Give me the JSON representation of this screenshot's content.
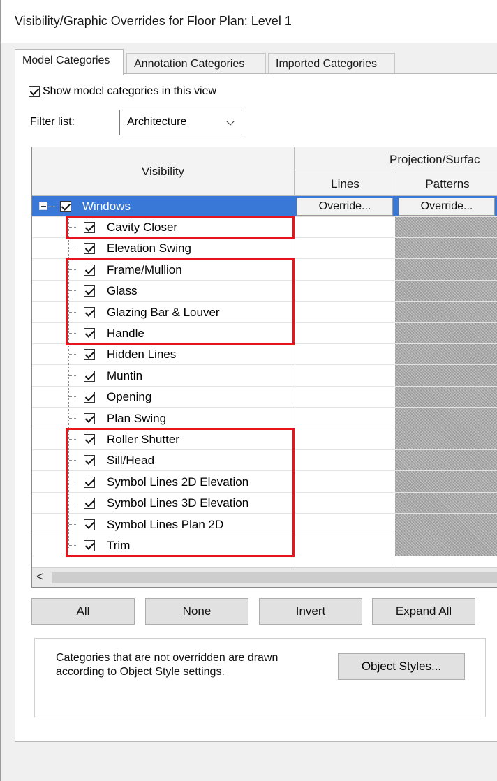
{
  "window": {
    "title": "Visibility/Graphic Overrides for Floor Plan: Level 1"
  },
  "tabs": [
    {
      "label": "Model Categories",
      "active": true
    },
    {
      "label": "Annotation Categories",
      "active": false
    },
    {
      "label": "Imported Categories",
      "active": false
    }
  ],
  "show_model_categories": {
    "label": "Show model categories in this view",
    "checked": true
  },
  "filter": {
    "label": "Filter list:",
    "value": "Architecture"
  },
  "table": {
    "header": {
      "visibility": "Visibility",
      "projection_surface": "Projection/Surfac",
      "lines": "Lines",
      "patterns": "Patterns"
    },
    "parent": {
      "name": "Windows",
      "checked": true,
      "selected": true,
      "lines_button": "Override...",
      "patterns_button": "Override..."
    },
    "children": [
      {
        "name": "Cavity Closer",
        "checked": true
      },
      {
        "name": "Elevation Swing",
        "checked": true
      },
      {
        "name": "Frame/Mullion",
        "checked": true
      },
      {
        "name": "Glass",
        "checked": true
      },
      {
        "name": "Glazing Bar & Louver",
        "checked": true
      },
      {
        "name": "Handle",
        "checked": true
      },
      {
        "name": "Hidden Lines",
        "checked": true
      },
      {
        "name": "Muntin",
        "checked": true
      },
      {
        "name": "Opening",
        "checked": true
      },
      {
        "name": "Plan Swing",
        "checked": true
      },
      {
        "name": "Roller Shutter",
        "checked": true
      },
      {
        "name": "Sill/Head",
        "checked": true
      },
      {
        "name": "Symbol Lines 2D Elevation",
        "checked": true
      },
      {
        "name": "Symbol Lines 3D Elevation",
        "checked": true
      },
      {
        "name": "Symbol Lines Plan 2D",
        "checked": true
      },
      {
        "name": "Trim",
        "checked": true
      }
    ]
  },
  "scrollbar": {
    "left_arrow": "<"
  },
  "buttons": {
    "all": "All",
    "none": "None",
    "invert": "Invert",
    "expand_all": "Expand All"
  },
  "note": {
    "text": "Categories that are not overridden are drawn according to Object Style settings.",
    "object_styles_button": "Object Styles..."
  },
  "highlight_color": "#e8141c",
  "selection_color": "#3a78d8"
}
